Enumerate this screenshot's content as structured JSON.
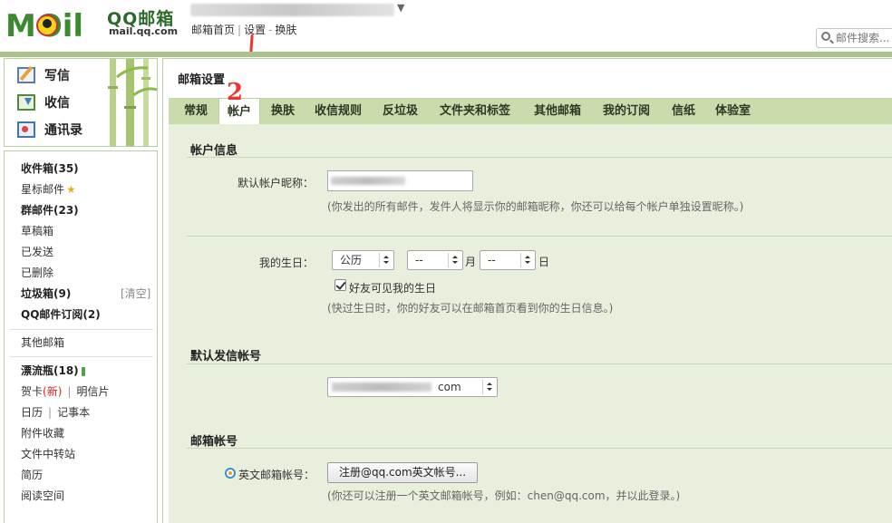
{
  "header": {
    "logo_text": "MOil",
    "brand": "QQ邮箱",
    "domain": "mail.qq.com",
    "top_links": [
      "邮箱首页",
      "设置",
      "换肤"
    ],
    "annotation_1": "1",
    "search_placeholder": "邮件搜索..."
  },
  "sidebar": {
    "actions": [
      {
        "label": "写信",
        "icon": "compose-icon"
      },
      {
        "label": "收信",
        "icon": "inbox-download-icon"
      },
      {
        "label": "通讯录",
        "icon": "contacts-icon"
      }
    ],
    "inbox": "收件箱(35)",
    "starred": "星标邮件",
    "group": "群邮件(23)",
    "drafts": "草稿箱",
    "sent": "已发送",
    "deleted": "已删除",
    "spam": "垃圾箱(9)",
    "spam_clear": "[清空]",
    "subscriptions": "QQ邮件订阅(2)",
    "other_mailboxes": "其他邮箱",
    "drift_bottle": "漂流瓶(18)",
    "greeting_card": "贺卡",
    "greeting_new": "(新)",
    "postcard": "明信片",
    "calendar": "日历",
    "notepad": "记事本",
    "attachments": "附件收藏",
    "file_transfer": "文件中转站",
    "resume": "简历",
    "reading_space": "阅读空间"
  },
  "main": {
    "title": "邮箱设置",
    "annotation_2": "2",
    "tabs": [
      "常规",
      "帐户",
      "换肤",
      "收信规则",
      "反垃圾",
      "文件夹和标签",
      "其他邮箱",
      "我的订阅",
      "信纸",
      "体验室"
    ],
    "active_tab": "帐户"
  },
  "account_info": {
    "section_title": "帐户信息",
    "nickname_label": "默认帐户昵称：",
    "nickname_hint": "(你发出的所有邮件，发件人将显示你的邮箱昵称，你还可以给每个帐户单独设置昵称。)",
    "birthday_label": "我的生日：",
    "calendar_type": "公历",
    "month_value": "--",
    "month_unit": "月",
    "day_value": "--",
    "day_unit": "日",
    "show_birthday_label": "好友可见我的生日",
    "show_birthday_checked": true,
    "birthday_hint": "(快过生日时，你的好友可以在邮箱首页看到你的生日信息。)"
  },
  "default_sender": {
    "section_title": "默认发信帐号",
    "value_suffix": "com"
  },
  "mail_account": {
    "section_title": "邮箱帐号",
    "english_label": "英文邮箱帐号：",
    "register_button": "注册@qq.com英文帐号...",
    "hint": "(你还可以注册一个英文邮箱帐号，例如：chen@qq.com，并以此登录。)"
  },
  "colors": {
    "accent_green": "#a9c48a",
    "tab_bar": "#c9dcae",
    "content_bg": "#e8f0dd",
    "annotation_red": "#e33333"
  }
}
